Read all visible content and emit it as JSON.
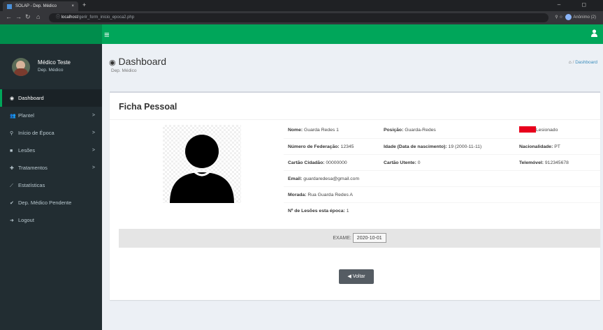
{
  "browser": {
    "tab_title": "SOLAP - Dep. Médico",
    "tab_close": "×",
    "new_tab": "+",
    "window_controls": "– ◻",
    "url_host": "localhost",
    "url_path": "/gerir_form_inicio_epoca2.php",
    "profile_label": "Anônimo (2)"
  },
  "user": {
    "name": "Médico Teste",
    "role": "Dep. Médico"
  },
  "menu": [
    {
      "icon": "tachometer-icon",
      "label": "Dashboard",
      "chevron": ""
    },
    {
      "icon": "users-icon",
      "label": "Plantel",
      "chevron": ">"
    },
    {
      "icon": "season-icon",
      "label": "Início de Época",
      "chevron": ">"
    },
    {
      "icon": "injury-icon",
      "label": "Lesões",
      "chevron": ">"
    },
    {
      "icon": "treatment-icon",
      "label": "Tratamentos",
      "chevron": ">"
    },
    {
      "icon": "chart-icon",
      "label": "Estatísticas",
      "chevron": ""
    },
    {
      "icon": "check-icon",
      "label": "Dep. Médico Pendente",
      "chevron": ""
    },
    {
      "icon": "logout-icon",
      "label": "Logout",
      "chevron": ""
    }
  ],
  "header": {
    "title": "Dashboard",
    "subtitle": "Dep. Médico",
    "breadcrumb_sep": "/",
    "breadcrumb": "Dashboard"
  },
  "card": {
    "title": "Ficha Pessoal",
    "status_label": "Lesionado",
    "status_color": "#e8001c",
    "nome_label": "Nome:",
    "nome_value": "Guarda Redes 1",
    "posicao_label": "Posição:",
    "posicao_value": "Guarda-Redes",
    "federacao_label": "Número de Federação:",
    "federacao_value": "12345",
    "idade_label": "Idade (Data de nascimento):",
    "idade_value": "19 (2000-11-11)",
    "nacionalidade_label": "Nacionalidade:",
    "nacionalidade_value": "PT",
    "cc_label": "Cartão Cidadão:",
    "cc_value": "00000000",
    "utente_label": "Cartão Utente:",
    "utente_value": "0",
    "telemovel_label": "Telemóvel:",
    "telemovel_value": "912345678",
    "email_label": "Email:",
    "email_value": "guardaredesa@gmail.com",
    "morada_label": "Morada:",
    "morada_value": "Rua Guarda Redes A",
    "lesoes_label": "Nº de Lesões esta época:",
    "lesoes_value": "1",
    "exame_label": "EXAME:",
    "exame_value": "2020-10-01",
    "back_label": "Voltar"
  }
}
